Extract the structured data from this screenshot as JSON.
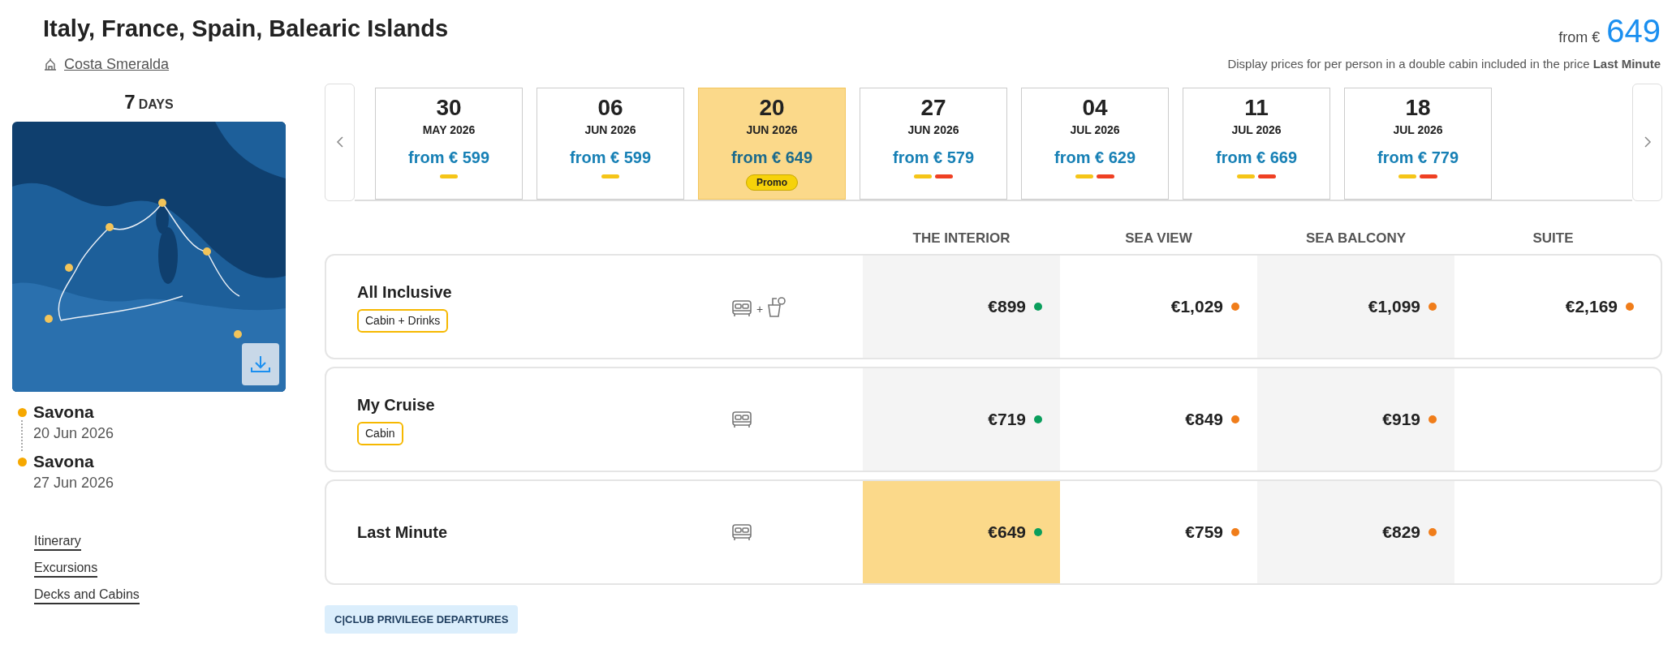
{
  "header": {
    "title": "Italy, France, Spain, Balearic Islands",
    "ship": "Costa Smeralda",
    "price_prefix": "from €",
    "price": "649",
    "note": "Display prices for per person in a double cabin included in the price **Last Minute**"
  },
  "sidebar": {
    "days_number": "7",
    "days_label": "DAYS",
    "map": {
      "kind": "picture"
    },
    "ports": [
      {
        "name": "Savona",
        "date": "20 Jun 2026"
      },
      {
        "name": "Savona",
        "date": "27 Jun 2026"
      }
    ],
    "links": [
      "Itinerary",
      "Excursions",
      "Decks and Cabins"
    ]
  },
  "dates": [
    {
      "day": "30",
      "month": "MAY 2026",
      "price": "from € 599",
      "selected": false,
      "markers": [
        {
          "color": "#f5c518"
        }
      ]
    },
    {
      "day": "06",
      "month": "JUN 2026",
      "price": "from € 599",
      "selected": false,
      "markers": [
        {
          "color": "#f5c518"
        }
      ]
    },
    {
      "day": "20",
      "month": "JUN 2026",
      "price": "from € 649",
      "selected": true,
      "badge": "Promo"
    },
    {
      "day": "27",
      "month": "JUN 2026",
      "price": "from € 579",
      "selected": false,
      "markers": [
        {
          "color": "#f5c518"
        },
        {
          "color": "#ef4023"
        }
      ]
    },
    {
      "day": "04",
      "month": "JUL 2026",
      "price": "from € 629",
      "selected": false,
      "markers": [
        {
          "color": "#f5c518"
        },
        {
          "color": "#ef4023"
        }
      ]
    },
    {
      "day": "11",
      "month": "JUL 2026",
      "price": "from € 669",
      "selected": false,
      "markers": [
        {
          "color": "#f5c518"
        },
        {
          "color": "#ef4023"
        }
      ]
    },
    {
      "day": "18",
      "month": "JUL 2026",
      "price": "from € 779",
      "selected": false,
      "markers": [
        {
          "color": "#f5c518"
        },
        {
          "color": "#ef4023"
        }
      ]
    }
  ],
  "table": {
    "columns": [
      "THE INTERIOR",
      "SEA VIEW",
      "SEA BALCONY",
      "SUITE"
    ],
    "rows": [
      {
        "name": "All Inclusive",
        "tag": "Cabin + Drinks",
        "kind": "cabin_drinks",
        "plus_sign": "+",
        "cells": [
          {
            "price": "€899",
            "color": "#0a9e5c",
            "selected": false
          },
          {
            "price": "€1,029",
            "color": "#f07d1a",
            "selected": false
          },
          {
            "price": "€1,099",
            "color": "#f07d1a",
            "selected": false
          },
          {
            "price": "€2,169",
            "color": "#f07d1a",
            "selected": false
          }
        ]
      },
      {
        "name": "My Cruise",
        "tag": "Cabin",
        "kind": "cabin",
        "cells": [
          {
            "price": "€719",
            "color": "#0a9e5c",
            "selected": false
          },
          {
            "price": "€849",
            "color": "#f07d1a",
            "selected": false
          },
          {
            "price": "€919",
            "color": "#f07d1a",
            "selected": false
          }
        ]
      },
      {
        "name": "Last Minute",
        "kind": "cabin",
        "cells": [
          {
            "price": "€649",
            "color": "#0a9e5c",
            "selected": true
          },
          {
            "price": "€759",
            "color": "#f07d1a",
            "selected": false
          },
          {
            "price": "€829",
            "color": "#f07d1a",
            "selected": false
          }
        ]
      }
    ]
  },
  "club_badge": "C|CLUB PRIVILEGE DEPARTURES"
}
